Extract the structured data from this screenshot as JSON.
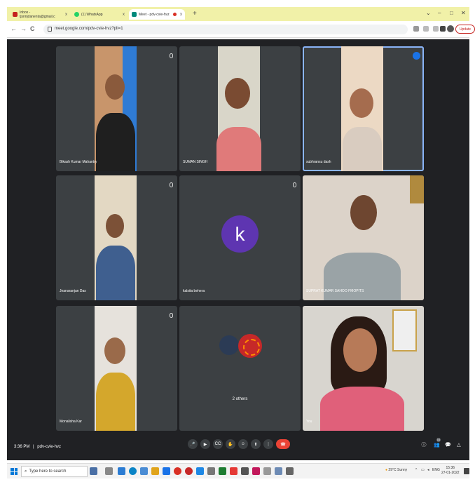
{
  "browser": {
    "tabs": [
      {
        "label": "Inbox - tjsnnjdanenta@gmail.c",
        "favicon_color": "#c5221f",
        "active": false
      },
      {
        "label": "(1) WhatsApp",
        "favicon_color": "#25d366",
        "active": false
      },
      {
        "label": "Meet - pdv-cvie-hvz",
        "favicon_color": "#00897b",
        "active": true
      }
    ],
    "tab_close": "x",
    "new_tab": "+",
    "window_controls": [
      "⌄",
      "–",
      "□",
      "✕"
    ],
    "nav": [
      "←",
      "→",
      "C"
    ],
    "url": "meet.google.com/pdv-cvie-hvz?pli=1",
    "update_label": "Update"
  },
  "meet": {
    "participants": [
      {
        "name": "Bikash Kumar Mahantry",
        "muted": true
      },
      {
        "name": "SUMAN SINGH",
        "muted": false
      },
      {
        "name": "subhransu dash",
        "muted": false,
        "speaking": true
      },
      {
        "name": "Jnanaranjan Das",
        "muted": true
      },
      {
        "name": "kalsita behera",
        "muted": true,
        "avatar_letter": "k",
        "avatar_color": "#5e35b1"
      },
      {
        "name": "SUPRAT KUMAR SAHOO FMOPITS",
        "muted": false
      },
      {
        "name": "Monalisha Kar",
        "muted": true
      },
      {
        "name": "2 others",
        "muted": false
      },
      {
        "name": "You",
        "muted": false
      }
    ],
    "meeting_time": "3:36 PM",
    "meeting_code": "pdv-cvie-hvz",
    "separator": "|",
    "people_count": "10"
  },
  "controls": {
    "mic": "🎤",
    "camera": "▶",
    "captions": "CC",
    "raise_hand": "✋",
    "emoji": "☺",
    "present": "⬆",
    "more": "⋮",
    "end_call": "☎",
    "info": "ⓘ",
    "people": "👥",
    "chat": "💬",
    "activities": "△"
  },
  "taskbar": {
    "search_placeholder": "Type here to search",
    "search_icon": "⌕",
    "weather": "29°C Sunny",
    "tray_chevron": "^",
    "language": "ENG",
    "time": "15:36",
    "date": "27-01-2022"
  }
}
